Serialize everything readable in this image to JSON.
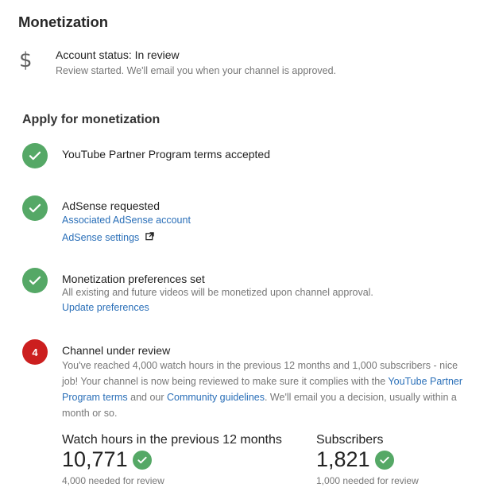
{
  "header": {
    "title": "Monetization"
  },
  "account": {
    "status": "Account status: In review",
    "detail": "Review started. We'll email you when your channel is approved."
  },
  "apply": {
    "title": "Apply for monetization",
    "step1": {
      "title": "YouTube Partner Program terms accepted"
    },
    "step2": {
      "title": "AdSense requested",
      "link1": "Associated AdSense account",
      "link2": "AdSense settings"
    },
    "step3": {
      "title": "Monetization preferences set",
      "detail": "All existing and future videos will be monetized upon channel approval.",
      "link": "Update preferences"
    },
    "step4": {
      "number": "4",
      "title": "Channel under review",
      "text_a": "You've reached 4,000 watch hours in the previous 12 months and 1,000 subscribers - nice job! Your channel is now being reviewed to make sure it complies with the ",
      "link_terms": "YouTube Partner Program terms",
      "text_b": " and our ",
      "link_guidelines": "Community guidelines",
      "text_c": ". We'll email you a decision, usually within a month or so."
    }
  },
  "stats": {
    "watch": {
      "label": "Watch hours in the previous 12 months",
      "value": "10,771",
      "note": "4,000 needed for review"
    },
    "subs": {
      "label": "Subscribers",
      "value": "1,821",
      "note": "1,000 needed for review"
    }
  },
  "colors": {
    "success": "#55a866",
    "alert": "#cc1f1f",
    "link": "#2a6fb8"
  },
  "icons": {
    "account": "dollar-icon",
    "done": "check-icon",
    "external": "external-link-icon"
  }
}
